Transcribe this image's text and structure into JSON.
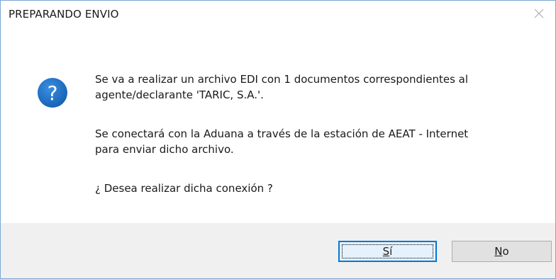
{
  "dialog": {
    "title": "PREPARANDO ENVIO",
    "close_glyph": "✕"
  },
  "message": {
    "line1": "Se va a realizar un archivo EDI con 1 documentos correspondientes al",
    "line2": "agente/declarante 'TARIC, S.A.'.",
    "line3": "Se conectará con la Aduana a través de la estación de AEAT - Internet",
    "line4": "para enviar dicho archivo.",
    "line5": "¿ Desea realizar dicha conexión ?",
    "icon": "question-icon",
    "icon_color": "#1c6fc2"
  },
  "buttons": {
    "yes_label_mnemonic": "S",
    "yes_label_rest": "í",
    "no_label_mnemonic": "N",
    "no_label_rest": "o"
  }
}
